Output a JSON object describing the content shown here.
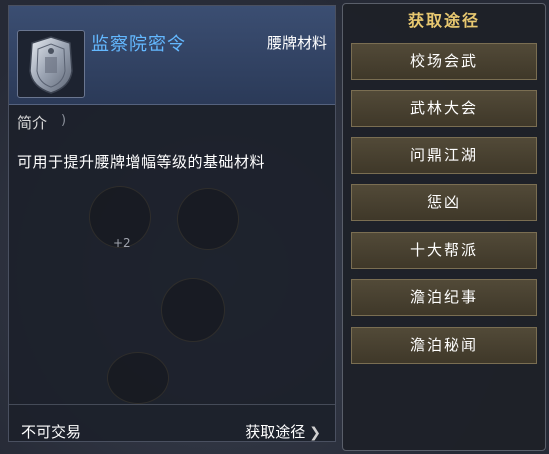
{
  "item": {
    "name": "监察院密令",
    "category": "腰牌材料",
    "section_heading": "简介",
    "description": "可用于提升腰牌增幅等级的基础材料",
    "trade_status": "不可交易",
    "source_link": "获取途径"
  },
  "faded": {
    "count": "+2"
  },
  "sources": {
    "title": "获取途径",
    "items": [
      "校场会武",
      "武林大会",
      "问鼎江湖",
      "惩凶",
      "十大帮派",
      "澹泊纪事",
      "澹泊秘闻"
    ]
  },
  "colors": {
    "name_blue": "#63b8ff",
    "title_gold": "#e8c870",
    "button_bg": "#4a4333"
  },
  "icons": {
    "item_icon": "silver-plaque-icon",
    "link_chevron": "chevron-right-icon"
  }
}
